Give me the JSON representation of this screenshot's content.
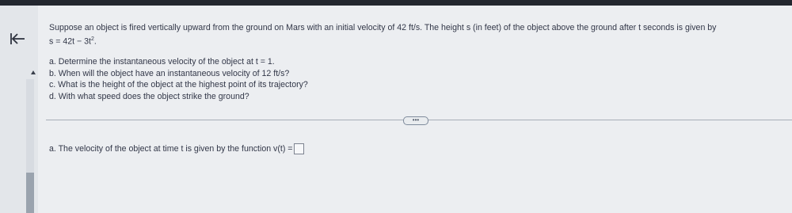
{
  "nav": {
    "back_icon": "arrow-bar-left-icon",
    "collapse_icon": "triangle-up-icon"
  },
  "question": {
    "text": "Suppose an object is fired vertically upward from the ground on Mars with an initial velocity of 42 ft/s. The height s (in feet) of the object above the ground after t seconds is given by",
    "formula_main": "s = 42t − 3t",
    "formula_exp": "2",
    "formula_end": ".",
    "parts": [
      "a. Determine the instantaneous velocity of the object at t = 1.",
      "b. When will the object have an instantaneous velocity of 12 ft/s?",
      "c. What is the height of the object at the highest point of its trajectory?",
      "d. With what speed does the object strike the ground?"
    ]
  },
  "more_button": "•••",
  "answer": {
    "prompt": "a. The velocity of the object at time t is given by the function v(t) ="
  },
  "colors": {
    "background": "#eceef1",
    "top_bar": "#23272f",
    "text": "#323748",
    "divider": "#a7adb7"
  }
}
